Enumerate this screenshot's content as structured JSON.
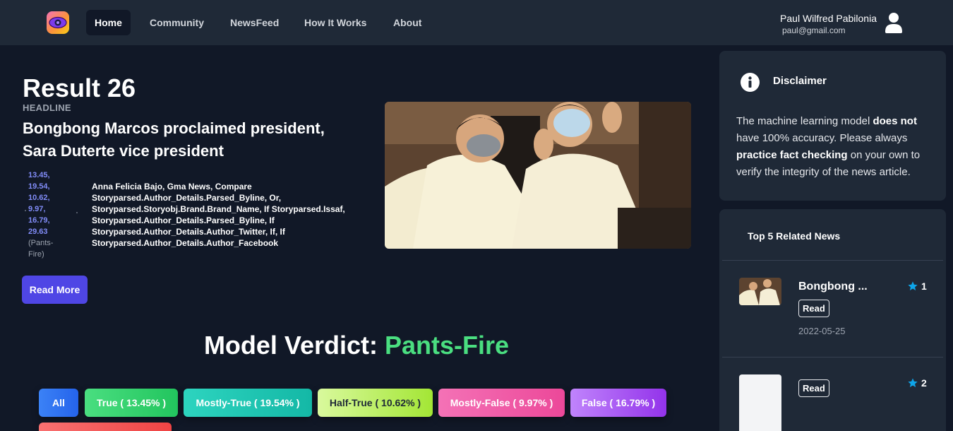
{
  "nav": {
    "links": [
      "Home",
      "Community",
      "NewsFeed",
      "How It Works",
      "About"
    ],
    "active": "Home"
  },
  "user": {
    "name": "Paul Wilfred Pabilonia",
    "email": "paul@gmail.com"
  },
  "result": {
    "title": "Result 26",
    "headline_label": "HEADLINE",
    "headline": "Bongbong Marcos proclaimed president, Sara Duterte vice president",
    "scores": [
      "13.45,",
      "19.54,",
      "10.62,",
      "9.97,",
      "16.79,",
      "29.63"
    ],
    "score_verdict": "(Pants-Fire)",
    "authors": "Anna Felicia Bajo, Gma News, Compare Storyparsed.Author_Details.Parsed_Byline, Or, Storyparsed.Storyobj.Brand.Brand_Name, If Storyparsed.Issaf, Storyparsed.Author_Details.Parsed_Byline, If Storyparsed.Author_Details.Author_Twitter, If, If Storyparsed.Author_Details.Author_Facebook",
    "read_more_label": "Read More"
  },
  "verdict": {
    "prefix": "Model Verdict:",
    "value": "Pants-Fire"
  },
  "filters": {
    "all": "All",
    "true": "True ( 13.45% )",
    "mostly_true": "Mostly-True ( 19.54% )",
    "half_true": "Half-True ( 10.62% )",
    "mostly_false": "Mostly-False ( 9.97% )",
    "false": "False ( 16.79% )"
  },
  "disclaimer": {
    "title": "Disclaimer",
    "text_1": "The machine learning model ",
    "bold_1": "does not",
    "text_2": " have 100% accuracy. Please always ",
    "bold_2": "practice fact checking",
    "text_3": " on your own to verify the integrity of the news article."
  },
  "related": {
    "title": "Top 5 Related News",
    "items": [
      {
        "title": "Bongbong ...",
        "read_label": "Read",
        "date": "2022-05-25",
        "rank": "1"
      },
      {
        "title": "",
        "read_label": "Read",
        "date": "",
        "rank": "2"
      }
    ]
  },
  "colors": {
    "background": "#111827",
    "navbar": "#1f2937",
    "accent": "#4f46e5",
    "verdict": "#4ade80"
  }
}
